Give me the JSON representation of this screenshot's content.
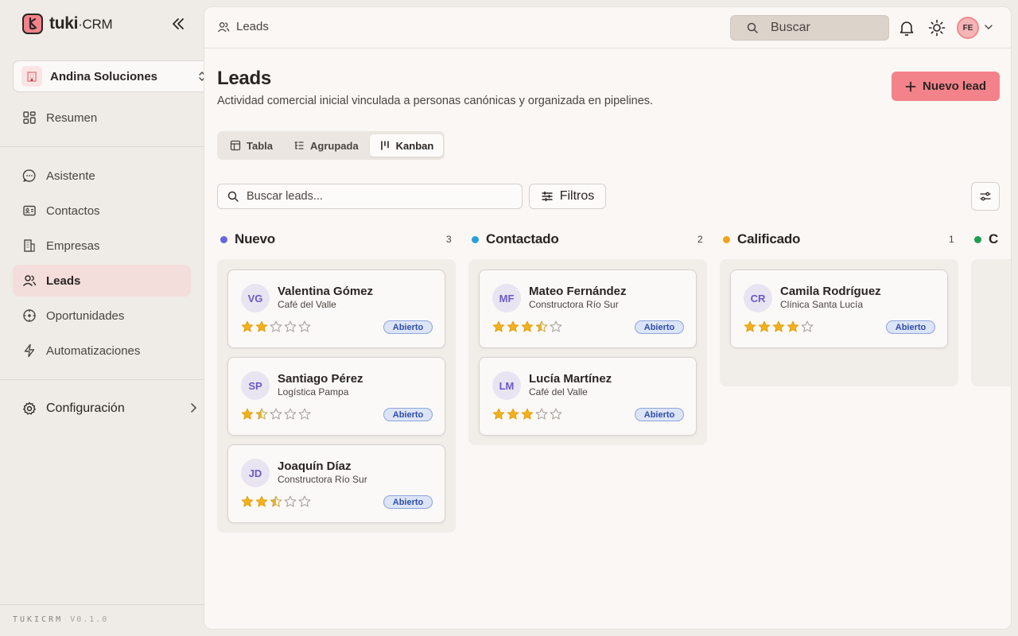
{
  "app": {
    "logo_text": "tuki",
    "logo_suffix": "CRM",
    "version_brand": "TUKICRM",
    "version": "V0.1.0"
  },
  "org": {
    "name": "Andina Soluciones"
  },
  "nav": {
    "summary": "Resumen",
    "items": [
      "Asistente",
      "Contactos",
      "Empresas",
      "Leads",
      "Oportunidades",
      "Automatizaciones"
    ],
    "config": "Configuración"
  },
  "topbar": {
    "breadcrumb": "Leads",
    "search_placeholder": "Buscar",
    "avatar_initials": "FE"
  },
  "page": {
    "title": "Leads",
    "subtitle": "Actividad comercial inicial vinculada a personas canónicas y organizada en pipelines.",
    "new_button": "Nuevo lead"
  },
  "views": {
    "tabs": [
      "Tabla",
      "Agrupada",
      "Kanban"
    ],
    "active": "Kanban"
  },
  "toolbar": {
    "search_placeholder": "Buscar leads...",
    "filters_label": "Filtros"
  },
  "colors": {
    "accent": "#f4828a",
    "nuevo": "#6b63e0",
    "contactado": "#2aa0db",
    "calificado": "#f2a21b",
    "next": "#1f9d52"
  },
  "kanban": {
    "columns": [
      {
        "title": "Nuevo",
        "count": "3",
        "cards": [
          {
            "initials": "VG",
            "name": "Valentina Gómez",
            "company": "Café del Valle",
            "rating": 2,
            "status": "Abierto"
          },
          {
            "initials": "SP",
            "name": "Santiago Pérez",
            "company": "Logística Pampa",
            "rating": 1.5,
            "status": "Abierto"
          },
          {
            "initials": "JD",
            "name": "Joaquín Díaz",
            "company": "Constructora Río Sur",
            "rating": 2.5,
            "status": "Abierto"
          }
        ]
      },
      {
        "title": "Contactado",
        "count": "2",
        "cards": [
          {
            "initials": "MF",
            "name": "Mateo Fernández",
            "company": "Constructora Río Sur",
            "rating": 3.5,
            "status": "Abierto"
          },
          {
            "initials": "LM",
            "name": "Lucía Martínez",
            "company": "Café del Valle",
            "rating": 3,
            "status": "Abierto"
          }
        ]
      },
      {
        "title": "Calificado",
        "count": "1",
        "cards": [
          {
            "initials": "CR",
            "name": "Camila Rodríguez",
            "company": "Clínica Santa Lucía",
            "rating": 4,
            "status": "Abierto"
          }
        ]
      },
      {
        "title": "C",
        "count": "",
        "cards": []
      }
    ]
  }
}
